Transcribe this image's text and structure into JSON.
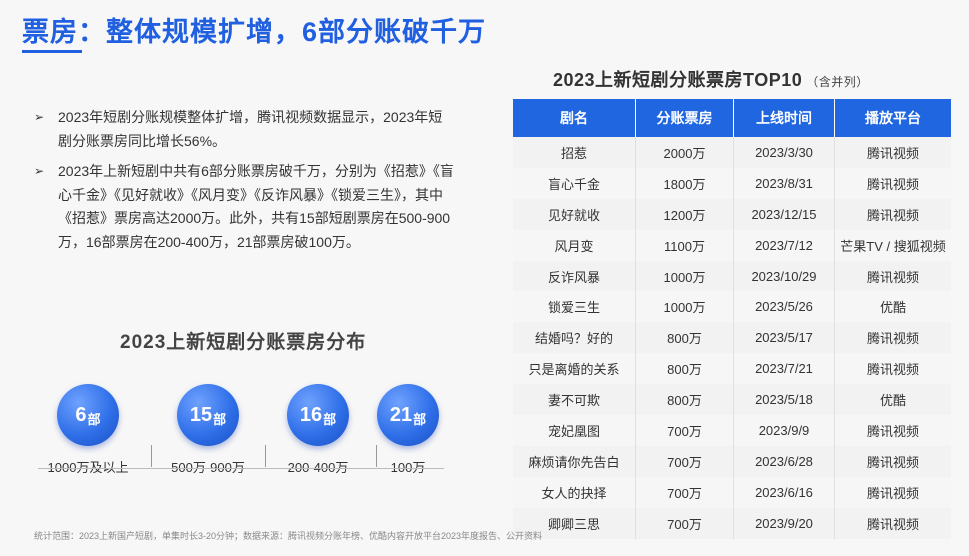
{
  "title": "票房：整体规模扩增，6部分账破千万",
  "bullets": [
    "2023年短剧分账规模整体扩增，腾讯视频数据显示，2023年短剧分账票房同比增长56%。",
    "2023年上新短剧中共有6部分账票房破千万，分别为《招惹》《盲心千金》《见好就收》《风月变》《反诈风暴》《锁爱三生》，其中《招惹》票房高达2000万。此外，共有15部短剧票房在500-900万，16部票房在200-400万，21部票房破100万。"
  ],
  "distribution": {
    "title": "2023上新短剧分账票房分布",
    "stats": [
      {
        "num": "6",
        "unit": "部",
        "label": "1000万及以上"
      },
      {
        "num": "15",
        "unit": "部",
        "label": "500万-900万"
      },
      {
        "num": "16",
        "unit": "部",
        "label": "200-400万"
      },
      {
        "num": "21",
        "unit": "部",
        "label": "100万"
      }
    ]
  },
  "table": {
    "title": "2023上新短剧分账票房TOP10",
    "note": "（含并列）",
    "headers": [
      "剧名",
      "分账票房",
      "上线时间",
      "播放平台"
    ],
    "rows": [
      [
        "招惹",
        "2000万",
        "2023/3/30",
        "腾讯视频"
      ],
      [
        "盲心千金",
        "1800万",
        "2023/8/31",
        "腾讯视频"
      ],
      [
        "见好就收",
        "1200万",
        "2023/12/15",
        "腾讯视频"
      ],
      [
        "风月变",
        "1100万",
        "2023/7/12",
        "芒果TV / 搜狐视频"
      ],
      [
        "反诈风暴",
        "1000万",
        "2023/10/29",
        "腾讯视频"
      ],
      [
        "锁爱三生",
        "1000万",
        "2023/5/26",
        "优酷"
      ],
      [
        "结婚吗？好的",
        "800万",
        "2023/5/17",
        "腾讯视频"
      ],
      [
        "只是离婚的关系",
        "800万",
        "2023/7/21",
        "腾讯视频"
      ],
      [
        "妻不可欺",
        "800万",
        "2023/5/18",
        "优酷"
      ],
      [
        "宠妃凰图",
        "700万",
        "2023/9/9",
        "腾讯视频"
      ],
      [
        "麻烦请你先告白",
        "700万",
        "2023/6/28",
        "腾讯视频"
      ],
      [
        "女人的抉择",
        "700万",
        "2023/6/16",
        "腾讯视频"
      ],
      [
        "卿卿三思",
        "700万",
        "2023/9/20",
        "腾讯视频"
      ]
    ]
  },
  "source": "统计范围：2023上新国产短剧，单集时长3-20分钟；数据来源：腾讯视频分账年榜、优酷内容开放平台2023年度报告、公开资料",
  "colors": {
    "accent": "#1f66e0",
    "title": "#1f5fe0",
    "background": "#f7f7f7"
  }
}
